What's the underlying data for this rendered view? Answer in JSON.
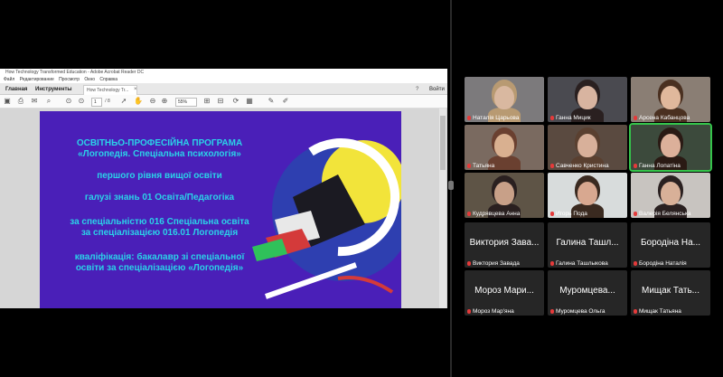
{
  "acrobat": {
    "window_title": "How Technology Transformed Education - Adobe Acrobat Reader DC",
    "menu": [
      "Файл",
      "Редактирование",
      "Просмотр",
      "Окно",
      "Справка"
    ],
    "tab_home": "Главная",
    "tab_tools": "Инструменты",
    "tab_doc": "How Technology Tr...",
    "sign_in": "Войти",
    "page_current": "1",
    "page_total": "/ 8",
    "zoom": "55%"
  },
  "slide": {
    "line1": "ОСВІТНЬО-ПРОФЕСІЙНА ПРОГРАМА",
    "line2": "«Логопедія. Спеціальна психологія»",
    "line3": "першого рівня вищої освіти",
    "line4": "галузі знань 01 Освіта/Педагогіка",
    "line5": "за спеціальністю 016 Спеціальна освіта",
    "line6": "за спеціалізацією 016.01 Логопедія",
    "line7": "кваліфікація: бакалавр зі спеціальної",
    "line8": "освіти за спеціалізацією «Логопедія»"
  },
  "participants": [
    {
      "name": "Наталія Царьова",
      "skin": "#d9b8a0",
      "hair": "#b89a72",
      "bg": "#7c7a7c"
    },
    {
      "name": "Ганна Мицик",
      "skin": "#d8b4a0",
      "hair": "#2a2020",
      "bg": "#4a4a50"
    },
    {
      "name": "Арсена Кабанцова",
      "skin": "#e0b89c",
      "hair": "#4a3020",
      "bg": "#8a7e74"
    },
    {
      "name": "Татьяна",
      "skin": "#d9b090",
      "hair": "#6a4030",
      "bg": "#7a6a60"
    },
    {
      "name": "Савченко Кристина",
      "skin": "#d8b09a",
      "hair": "#5a4030",
      "bg": "#5a4a40"
    },
    {
      "name": "Ганна Лопатіна",
      "skin": "#dcb09a",
      "hair": "#2a1a14",
      "bg": "#3c4a3c"
    },
    {
      "name": "Кудрявцева Анна",
      "skin": "#c8a088",
      "hair": "#2a2020",
      "bg": "#5e5446"
    },
    {
      "name": "Игорь Пода",
      "skin": "#d8a890",
      "hair": "#3a2a20",
      "bg": "#d8dcdc"
    },
    {
      "name": "Валерія Белянська",
      "skin": "#d8b098",
      "hair": "#2a2020",
      "bg": "#c8c4c0"
    },
    {
      "big": "Виктория Зава...",
      "name": "Виктория Завада"
    },
    {
      "big": "Галина Ташл...",
      "name": "Галина Ташлыкова"
    },
    {
      "big": "Бородіна На...",
      "name": "Бородіна Наталія"
    },
    {
      "big": "Мороз Мари...",
      "name": "Мороз Мар'яна"
    },
    {
      "big": "Муромцева...",
      "name": "Муромцева Ольга"
    },
    {
      "big": "Мищак Тать...",
      "name": "Мищак Татьяна"
    }
  ],
  "colors": {
    "active_speaker": "#35c44b",
    "slide_bg": "#4a1fb8",
    "slide_text": "#2ad3e8",
    "muted_mic": "#e43a3a"
  }
}
